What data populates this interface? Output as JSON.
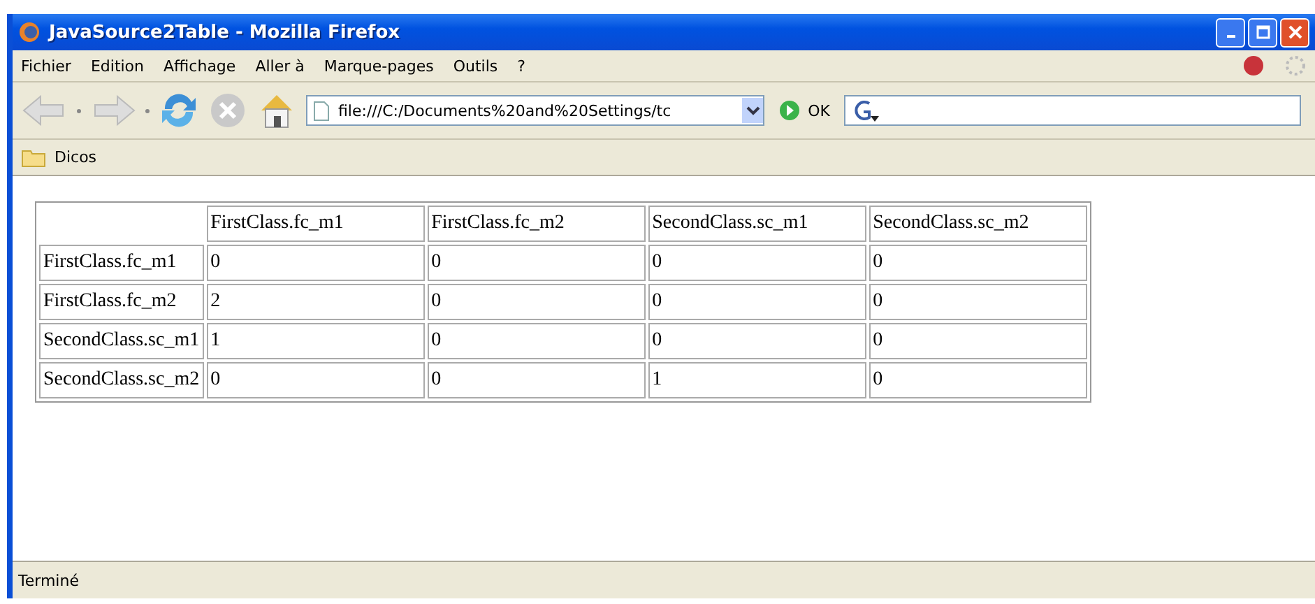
{
  "window": {
    "title": "JavaSource2Table - Mozilla Firefox"
  },
  "menu": [
    "Fichier",
    "Edition",
    "Affichage",
    "Aller à",
    "Marque-pages",
    "Outils",
    "?"
  ],
  "address_bar": {
    "value": "file:///C:/Documents%20and%20Settings/tc"
  },
  "go_button": "OK",
  "bookmarks": [
    "Dicos"
  ],
  "table": {
    "columns": [
      "FirstClass.fc_m1",
      "FirstClass.fc_m2",
      "SecondClass.sc_m1",
      "SecondClass.sc_m2"
    ],
    "rows": [
      {
        "header": "FirstClass.fc_m1",
        "cells": [
          "0",
          "0",
          "0",
          "0"
        ]
      },
      {
        "header": "FirstClass.fc_m2",
        "cells": [
          "2",
          "0",
          "0",
          "0"
        ]
      },
      {
        "header": "SecondClass.sc_m1",
        "cells": [
          "1",
          "0",
          "0",
          "0"
        ]
      },
      {
        "header": "SecondClass.sc_m2",
        "cells": [
          "0",
          "0",
          "1",
          "0"
        ]
      }
    ]
  },
  "status_bar": "Terminé"
}
